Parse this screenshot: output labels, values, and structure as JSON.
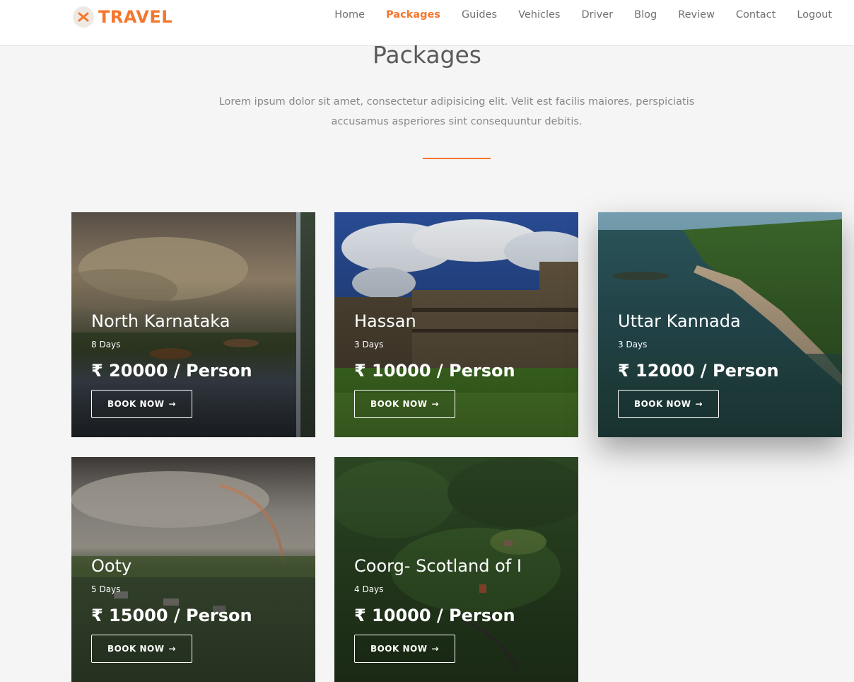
{
  "brand": {
    "name": "TRAVEL",
    "icon": "plane-icon",
    "color": "#f4772e"
  },
  "nav": {
    "links": [
      "Home",
      "Packages",
      "Guides",
      "Vehicles",
      "Driver",
      "Blog",
      "Review",
      "Contact",
      "Logout"
    ],
    "active": "Packages"
  },
  "section": {
    "title": "Packages",
    "description": "Lorem ipsum dolor sit amet, consectetur adipisicing elit. Velit est facilis maiores, perspiciatis accusamus asperiores sint consequuntur debitis."
  },
  "packages": [
    {
      "name": "North Karnataka",
      "days": "8 Days",
      "price": "₹ 20000 / Person",
      "button": "BOOK NOW",
      "button_icon": "arrow-right-icon"
    },
    {
      "name": "Hassan",
      "days": "3 Days",
      "price": "₹ 10000 / Person",
      "button": "BOOK NOW",
      "button_icon": "arrow-right-icon"
    },
    {
      "name": "Uttar Kannada",
      "days": "3 Days",
      "price": "₹ 12000 / Person",
      "button": "BOOK NOW",
      "button_icon": "arrow-right-icon"
    },
    {
      "name": "Ooty",
      "days": "5 Days",
      "price": "₹ 15000 / Person",
      "button": "BOOK NOW",
      "button_icon": "arrow-right-icon"
    },
    {
      "name": "Coorg- Scotland of I",
      "days": "4 Days",
      "price": "₹ 10000 / Person",
      "button": "BOOK NOW",
      "button_icon": "arrow-right-icon"
    }
  ],
  "colors": {
    "accent": "#f4772e",
    "page_bg": "#f5f5f5",
    "nav_text": "#707070"
  }
}
